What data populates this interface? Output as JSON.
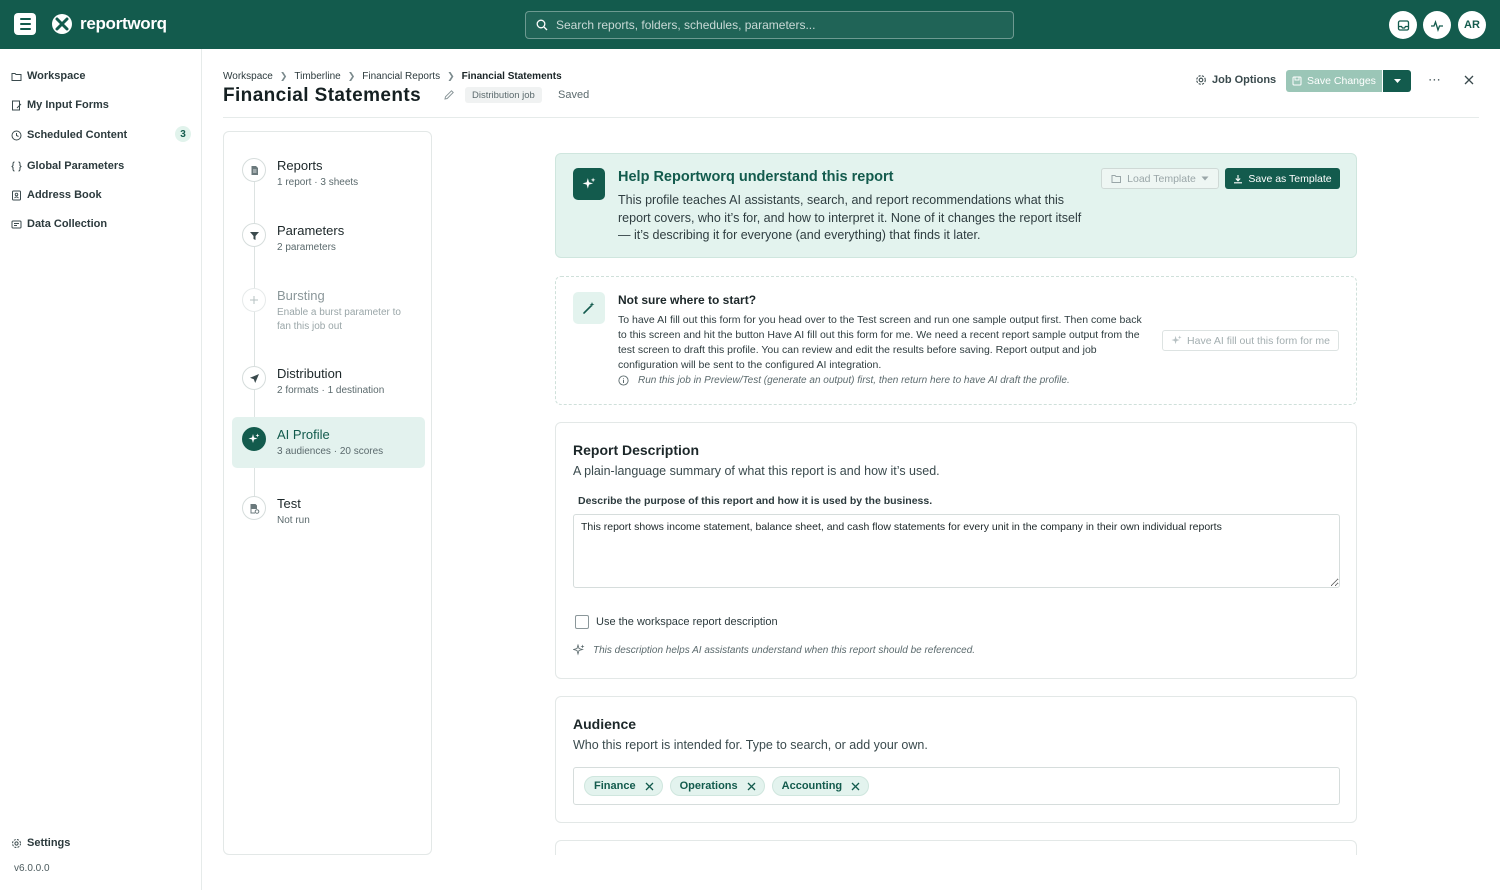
{
  "app": {
    "name": "reportworq",
    "search_placeholder": "Search reports, folders, schedules, parameters...",
    "user_initials": "AR",
    "version": "v6.0.0.0"
  },
  "nav": {
    "items": [
      {
        "label": "Workspace",
        "icon": "folder-icon"
      },
      {
        "label": "My Input Forms",
        "icon": "form-icon"
      },
      {
        "label": "Scheduled Content",
        "icon": "clock-icon",
        "badge": "3"
      },
      {
        "label": "Global Parameters",
        "icon": "braces-icon"
      },
      {
        "label": "Address Book",
        "icon": "address-book-icon"
      },
      {
        "label": "Data Collection",
        "icon": "data-collection-icon"
      }
    ],
    "settings_label": "Settings"
  },
  "header": {
    "breadcrumb": [
      "Workspace",
      "Timberline",
      "Financial Reports",
      "Financial Statements"
    ],
    "title": "Financial Statements",
    "badge": "Distribution job",
    "status": "Saved",
    "job_options": "Job Options",
    "save_changes": "Save Changes"
  },
  "steps": [
    {
      "title": "Reports",
      "subtitle": "1 report · 3 sheets",
      "state": "done"
    },
    {
      "title": "Parameters",
      "subtitle": "2 parameters",
      "state": "done"
    },
    {
      "title": "Bursting",
      "subtitle": "Enable a burst parameter to fan this job out",
      "state": "disabled"
    },
    {
      "title": "Distribution",
      "subtitle": "2 formats · 1 destination",
      "state": "done"
    },
    {
      "title": "AI Profile",
      "subtitle": "3 audiences · 20 scores",
      "state": "active"
    },
    {
      "title": "Test",
      "subtitle": "Not run",
      "state": "pending"
    }
  ],
  "help": {
    "title": "Help Reportworq understand this report",
    "text": "This profile teaches AI assistants, search, and report recommendations what this report covers, who it’s for, and how to interpret it. None of it changes the report itself — it’s describing it for everyone (and everything) that finds it later.",
    "load_template": "Load Template",
    "save_template": "Save as Template"
  },
  "start": {
    "title": "Not sure where to start?",
    "text": "To have AI fill out this form for you head over to the Test screen and run one sample output first. Then come back to this screen and hit the button Have AI fill out this form for me. We need a recent report sample output from the test screen to draft this profile. You can review and edit the results before saving. Report output and job configuration will be sent to the configured AI integration.",
    "hint": "Run this job in Preview/Test (generate an output) first, then return here to have AI draft the profile.",
    "ai_button": "Have AI fill out this form for me"
  },
  "description": {
    "title": "Report Description",
    "subtitle": "A plain-language summary of what this report is and how it’s used.",
    "field_label": "Describe the purpose of this report and how it is used by the business.",
    "value": "This report shows income statement, balance sheet, and cash flow statements for every unit in the company in their own individual reports",
    "checkbox_label": "Use the workspace report description",
    "hint": "This description helps AI assistants understand when this report should be referenced."
  },
  "audience": {
    "title": "Audience",
    "subtitle": "Who this report is intended for. Type to search, or add your own.",
    "tags": [
      "Finance",
      "Operations",
      "Accounting"
    ]
  },
  "colors": {
    "brand": "#135b4d",
    "accent_light": "#e3f3ee"
  }
}
